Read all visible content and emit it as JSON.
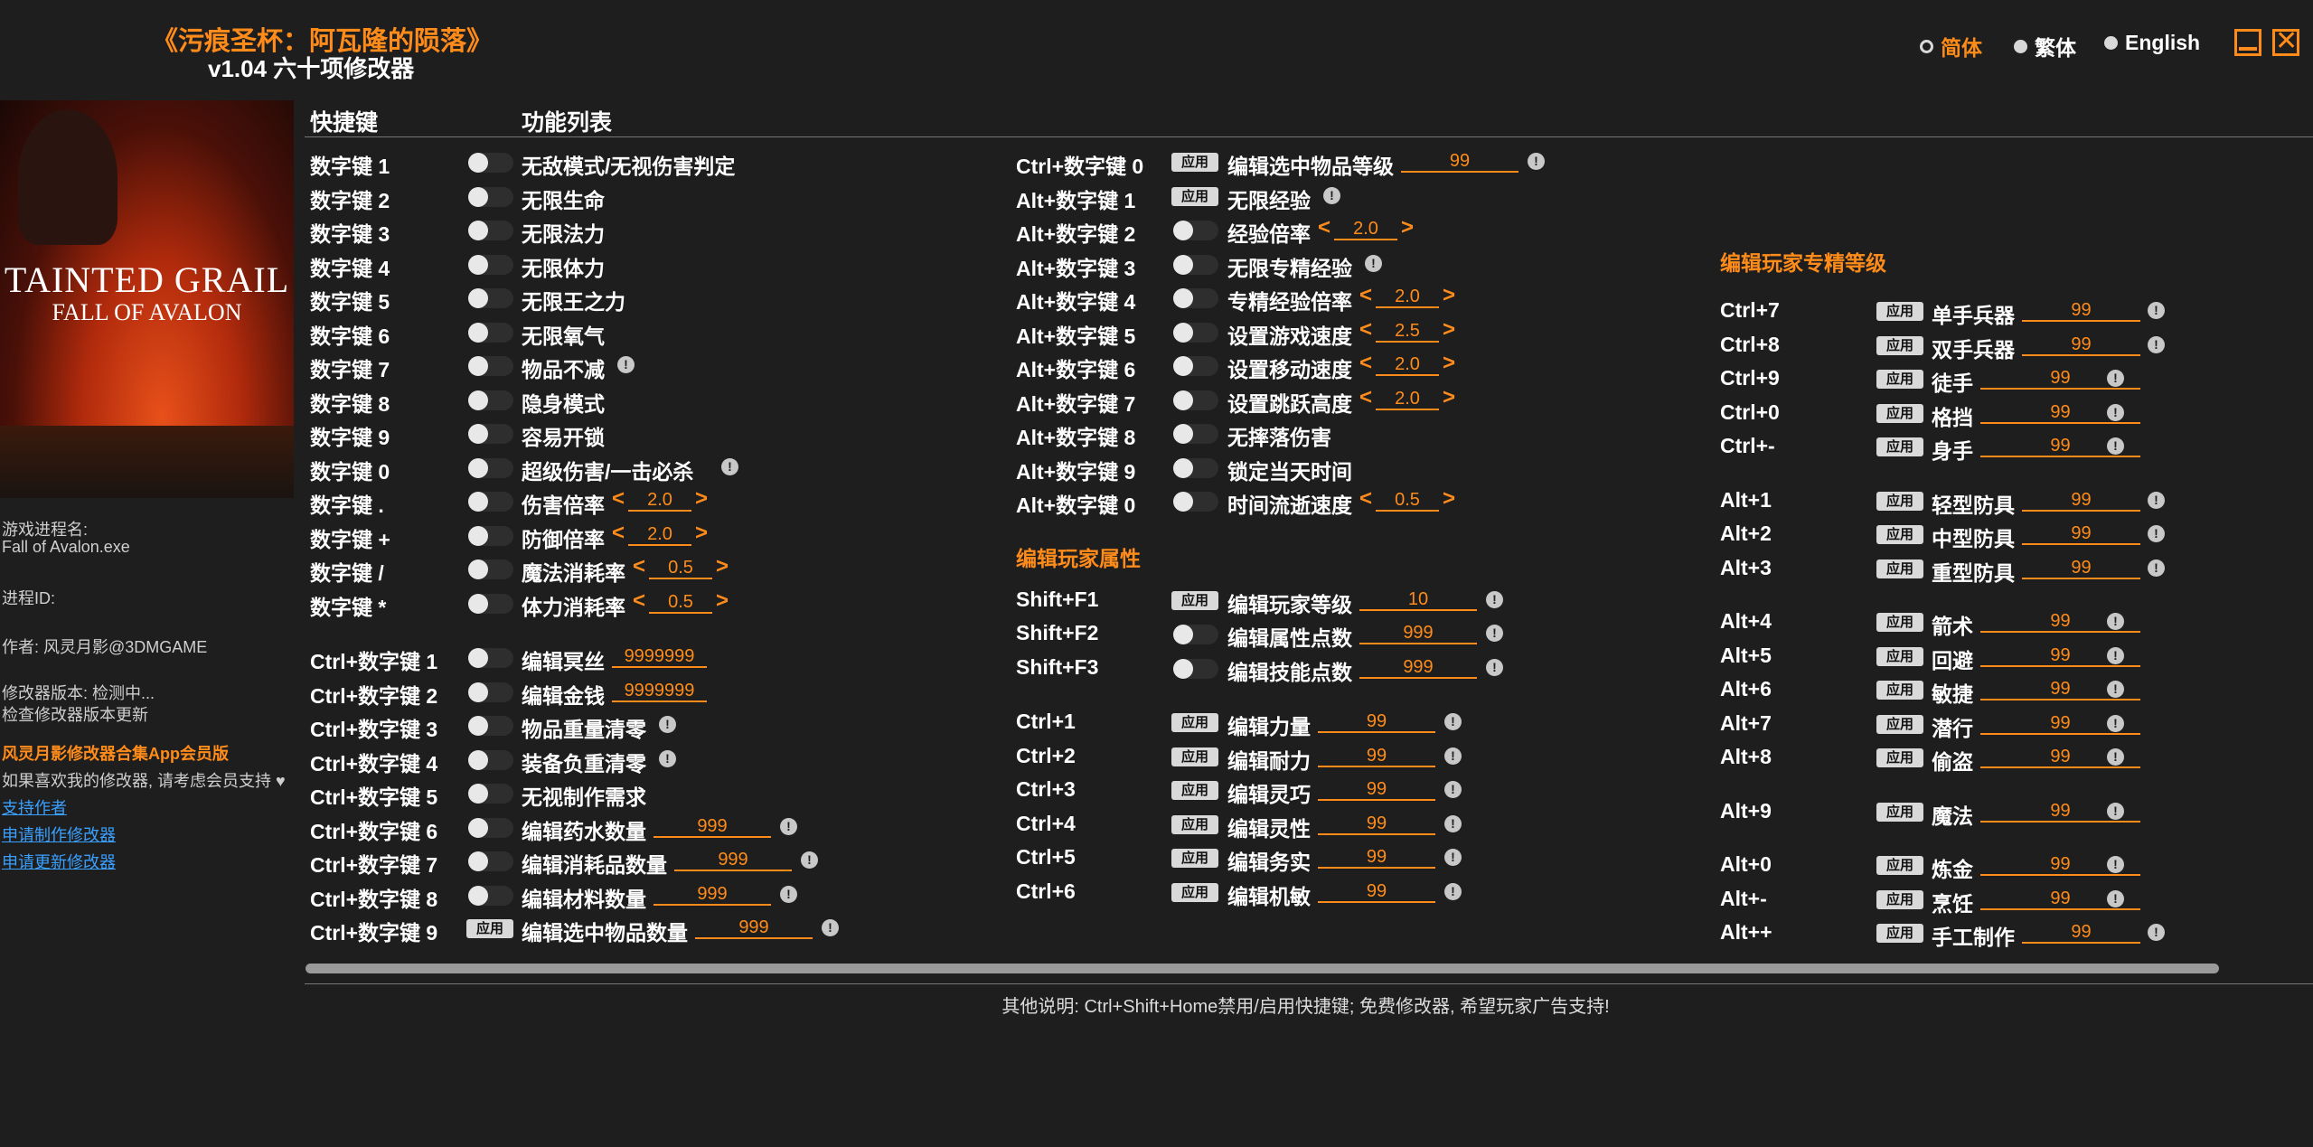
{
  "header": {
    "title": "《污痕圣杯：阿瓦隆的陨落》",
    "version": "v1.04 六十项修改器",
    "languages": [
      "简体",
      "繁体",
      "English"
    ]
  },
  "cover": {
    "logo_line1": "TAINTED GRAIL",
    "logo_line2": "FALL OF AVALON"
  },
  "side": {
    "process_label": "游戏进程名:",
    "process_name": "Fall of Avalon.exe",
    "pid_label": "进程ID:",
    "author": "作者: 风灵月影@3DMGAME",
    "version_status": "修改器版本: 检测中...",
    "check_update": "检查修改器版本更新",
    "app_promo": "风灵月影修改器合集App会员版",
    "support_text": "如果喜欢我的修改器, 请考虑会员支持 ♥",
    "support_author": "支持作者",
    "request_make": "申请制作修改器",
    "request_update": "申请更新修改器"
  },
  "table_header": {
    "hotkey": "快捷键",
    "features": "功能列表"
  },
  "apply_label": "应用",
  "col1": [
    {
      "key": "数字键 1",
      "label": "无敌模式/无视伤害判定",
      "ctl": "toggle"
    },
    {
      "key": "数字键 2",
      "label": "无限生命",
      "ctl": "toggle"
    },
    {
      "key": "数字键 3",
      "label": "无限法力",
      "ctl": "toggle"
    },
    {
      "key": "数字键 4",
      "label": "无限体力",
      "ctl": "toggle"
    },
    {
      "key": "数字键 5",
      "label": "无限王之力",
      "ctl": "toggle"
    },
    {
      "key": "数字键 6",
      "label": "无限氧气",
      "ctl": "toggle"
    },
    {
      "key": "数字键 7",
      "label": "物品不减",
      "ctl": "toggle",
      "info": true
    },
    {
      "key": "数字键 8",
      "label": "隐身模式",
      "ctl": "toggle"
    },
    {
      "key": "数字键 9",
      "label": "容易开锁",
      "ctl": "toggle"
    },
    {
      "key": "数字键 0",
      "label": "超级伤害/一击必杀",
      "ctl": "toggle",
      "info": true
    },
    {
      "key": "数字键 .",
      "label": "伤害倍率",
      "ctl": "toggle",
      "value": "2.0",
      "arrows": true
    },
    {
      "key": "数字键 +",
      "label": "防御倍率",
      "ctl": "toggle",
      "value": "2.0",
      "arrows": true
    },
    {
      "key": "数字键 /",
      "label": "魔法消耗率",
      "ctl": "toggle",
      "value": "0.5",
      "arrows": true
    },
    {
      "key": "数字键 *",
      "label": "体力消耗率",
      "ctl": "toggle",
      "value": "0.5",
      "arrows": true
    },
    {
      "key": "Ctrl+数字键 1",
      "label": "编辑冥丝",
      "ctl": "toggle",
      "value": "9999999"
    },
    {
      "key": "Ctrl+数字键 2",
      "label": "编辑金钱",
      "ctl": "toggle",
      "value": "9999999"
    },
    {
      "key": "Ctrl+数字键 3",
      "label": "物品重量清零",
      "ctl": "toggle",
      "info": true
    },
    {
      "key": "Ctrl+数字键 4",
      "label": "装备负重清零",
      "ctl": "toggle",
      "info": true
    },
    {
      "key": "Ctrl+数字键 5",
      "label": "无视制作需求",
      "ctl": "toggle"
    },
    {
      "key": "Ctrl+数字键 6",
      "label": "编辑药水数量",
      "ctl": "toggle",
      "value": "999",
      "info": true
    },
    {
      "key": "Ctrl+数字键 7",
      "label": "编辑消耗品数量",
      "ctl": "toggle",
      "value": "999",
      "info": true
    },
    {
      "key": "Ctrl+数字键 8",
      "label": "编辑材料数量",
      "ctl": "toggle",
      "value": "999",
      "info": true
    },
    {
      "key": "Ctrl+数字键 9",
      "label": "编辑选中物品数量",
      "ctl": "apply",
      "value": "999",
      "info": true
    }
  ],
  "col2": [
    {
      "key": "Ctrl+数字键 0",
      "label": "编辑选中物品等级",
      "ctl": "apply",
      "value": "99",
      "info": true
    },
    {
      "key": "Alt+数字键 1",
      "label": "无限经验",
      "ctl": "apply",
      "info": true
    },
    {
      "key": "Alt+数字键 2",
      "label": "经验倍率",
      "ctl": "toggle",
      "value": "2.0",
      "arrows": true
    },
    {
      "key": "Alt+数字键 3",
      "label": "无限专精经验",
      "ctl": "toggle",
      "info": true
    },
    {
      "key": "Alt+数字键 4",
      "label": "专精经验倍率",
      "ctl": "toggle",
      "value": "2.0",
      "arrows": true
    },
    {
      "key": "Alt+数字键 5",
      "label": "设置游戏速度",
      "ctl": "toggle",
      "value": "2.5",
      "arrows": true
    },
    {
      "key": "Alt+数字键 6",
      "label": "设置移动速度",
      "ctl": "toggle",
      "value": "2.0",
      "arrows": true
    },
    {
      "key": "Alt+数字键 7",
      "label": "设置跳跃高度",
      "ctl": "toggle",
      "value": "2.0",
      "arrows": true
    },
    {
      "key": "Alt+数字键 8",
      "label": "无摔落伤害",
      "ctl": "toggle"
    },
    {
      "key": "Alt+数字键 9",
      "label": "锁定当天时间",
      "ctl": "toggle"
    },
    {
      "key": "Alt+数字键 0",
      "label": "时间流逝速度",
      "ctl": "toggle",
      "value": "0.5",
      "arrows": true
    },
    {
      "section": "编辑玩家属性"
    },
    {
      "key": "Shift+F1",
      "label": "编辑玩家等级",
      "ctl": "apply",
      "value": "10",
      "info": true
    },
    {
      "key": "Shift+F2",
      "label": "编辑属性点数",
      "ctl": "toggle",
      "value": "999",
      "info": true
    },
    {
      "key": "Shift+F3",
      "label": "编辑技能点数",
      "ctl": "toggle",
      "value": "999",
      "info": true
    },
    {
      "key": "Ctrl+1",
      "label": "编辑力量",
      "ctl": "apply",
      "value": "99",
      "info": true
    },
    {
      "key": "Ctrl+2",
      "label": "编辑耐力",
      "ctl": "apply",
      "value": "99",
      "info": true
    },
    {
      "key": "Ctrl+3",
      "label": "编辑灵巧",
      "ctl": "apply",
      "value": "99",
      "info": true
    },
    {
      "key": "Ctrl+4",
      "label": "编辑灵性",
      "ctl": "apply",
      "value": "99",
      "info": true
    },
    {
      "key": "Ctrl+5",
      "label": "编辑务实",
      "ctl": "apply",
      "value": "99",
      "info": true
    },
    {
      "key": "Ctrl+6",
      "label": "编辑机敏",
      "ctl": "apply",
      "value": "99",
      "info": true
    }
  ],
  "col3_section": "编辑玩家专精等级",
  "col3": [
    {
      "key": "Ctrl+7",
      "label": "单手兵器",
      "value": "99"
    },
    {
      "key": "Ctrl+8",
      "label": "双手兵器",
      "value": "99"
    },
    {
      "key": "Ctrl+9",
      "label": "徒手",
      "value": "99"
    },
    {
      "key": "Ctrl+0",
      "label": "格挡",
      "value": "99"
    },
    {
      "key": "Ctrl+-",
      "label": "身手",
      "value": "99"
    },
    {
      "key": "Alt+1",
      "label": "轻型防具",
      "value": "99"
    },
    {
      "key": "Alt+2",
      "label": "中型防具",
      "value": "99"
    },
    {
      "key": "Alt+3",
      "label": "重型防具",
      "value": "99"
    },
    {
      "key": "Alt+4",
      "label": "箭术",
      "value": "99"
    },
    {
      "key": "Alt+5",
      "label": "回避",
      "value": "99"
    },
    {
      "key": "Alt+6",
      "label": "敏捷",
      "value": "99"
    },
    {
      "key": "Alt+7",
      "label": "潜行",
      "value": "99"
    },
    {
      "key": "Alt+8",
      "label": "偷盗",
      "value": "99"
    },
    {
      "key": "Alt+9",
      "label": "魔法",
      "value": "99"
    },
    {
      "key": "Alt+0",
      "label": "炼金",
      "value": "99"
    },
    {
      "key": "Alt+-",
      "label": "烹饪",
      "value": "99"
    },
    {
      "key": "Alt++",
      "label": "手工制作",
      "value": "99"
    }
  ],
  "footer": "其他说明: Ctrl+Shift+Home禁用/启用快捷键; 免费修改器, 希望玩家广告支持!",
  "colors": {
    "accent": "#ff8c1a",
    "background": "#1e1e1e",
    "link": "#3aa0ff"
  }
}
